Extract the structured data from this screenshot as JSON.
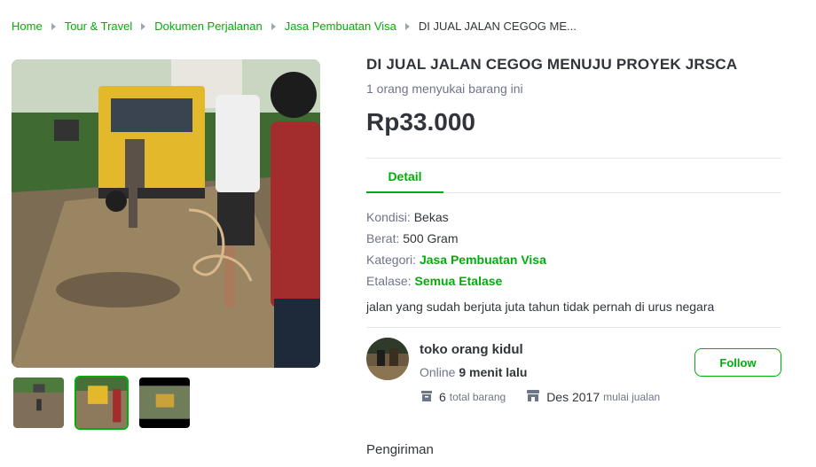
{
  "breadcrumb": {
    "items": [
      "Home",
      "Tour & Travel",
      "Dokumen Perjalanan",
      "Jasa Pembuatan Visa"
    ],
    "current": "DI JUAL JALAN CEGOG ME..."
  },
  "gallery": {
    "main_image": "muddy-road-truck-photo",
    "thumbnails": [
      "road-photo-1",
      "road-photo-2",
      "road-photo-3"
    ],
    "active_thumbnail": 1
  },
  "product": {
    "title": "DI JUAL JALAN CEGOG MENUJU PROYEK JRSCA",
    "likes": "1 orang menyukai barang ini",
    "price": "Rp33.000"
  },
  "tabs": {
    "detail": "Detail"
  },
  "specs": {
    "kondisi_label": "Kondisi:",
    "kondisi_value": "Bekas",
    "berat_label": "Berat:",
    "berat_value": "500 Gram",
    "kategori_label": "Kategori:",
    "kategori_value": "Jasa Pembuatan Visa",
    "etalase_label": "Etalase:",
    "etalase_value": "Semua Etalase"
  },
  "description": "jalan yang sudah berjuta juta tahun tidak pernah di urus negara",
  "shop": {
    "name": "toko orang kidul",
    "online_prefix": "Online",
    "online_time": "9 menit lalu",
    "follow_label": "Follow",
    "product_count": "6",
    "product_count_label": "total barang",
    "since": "Des 2017",
    "since_label": "mulai jualan"
  },
  "shipping": {
    "title": "Pengiriman"
  },
  "colors": {
    "accent": "#03ac0e",
    "text": "#31353b",
    "muted": "#6d7588"
  }
}
